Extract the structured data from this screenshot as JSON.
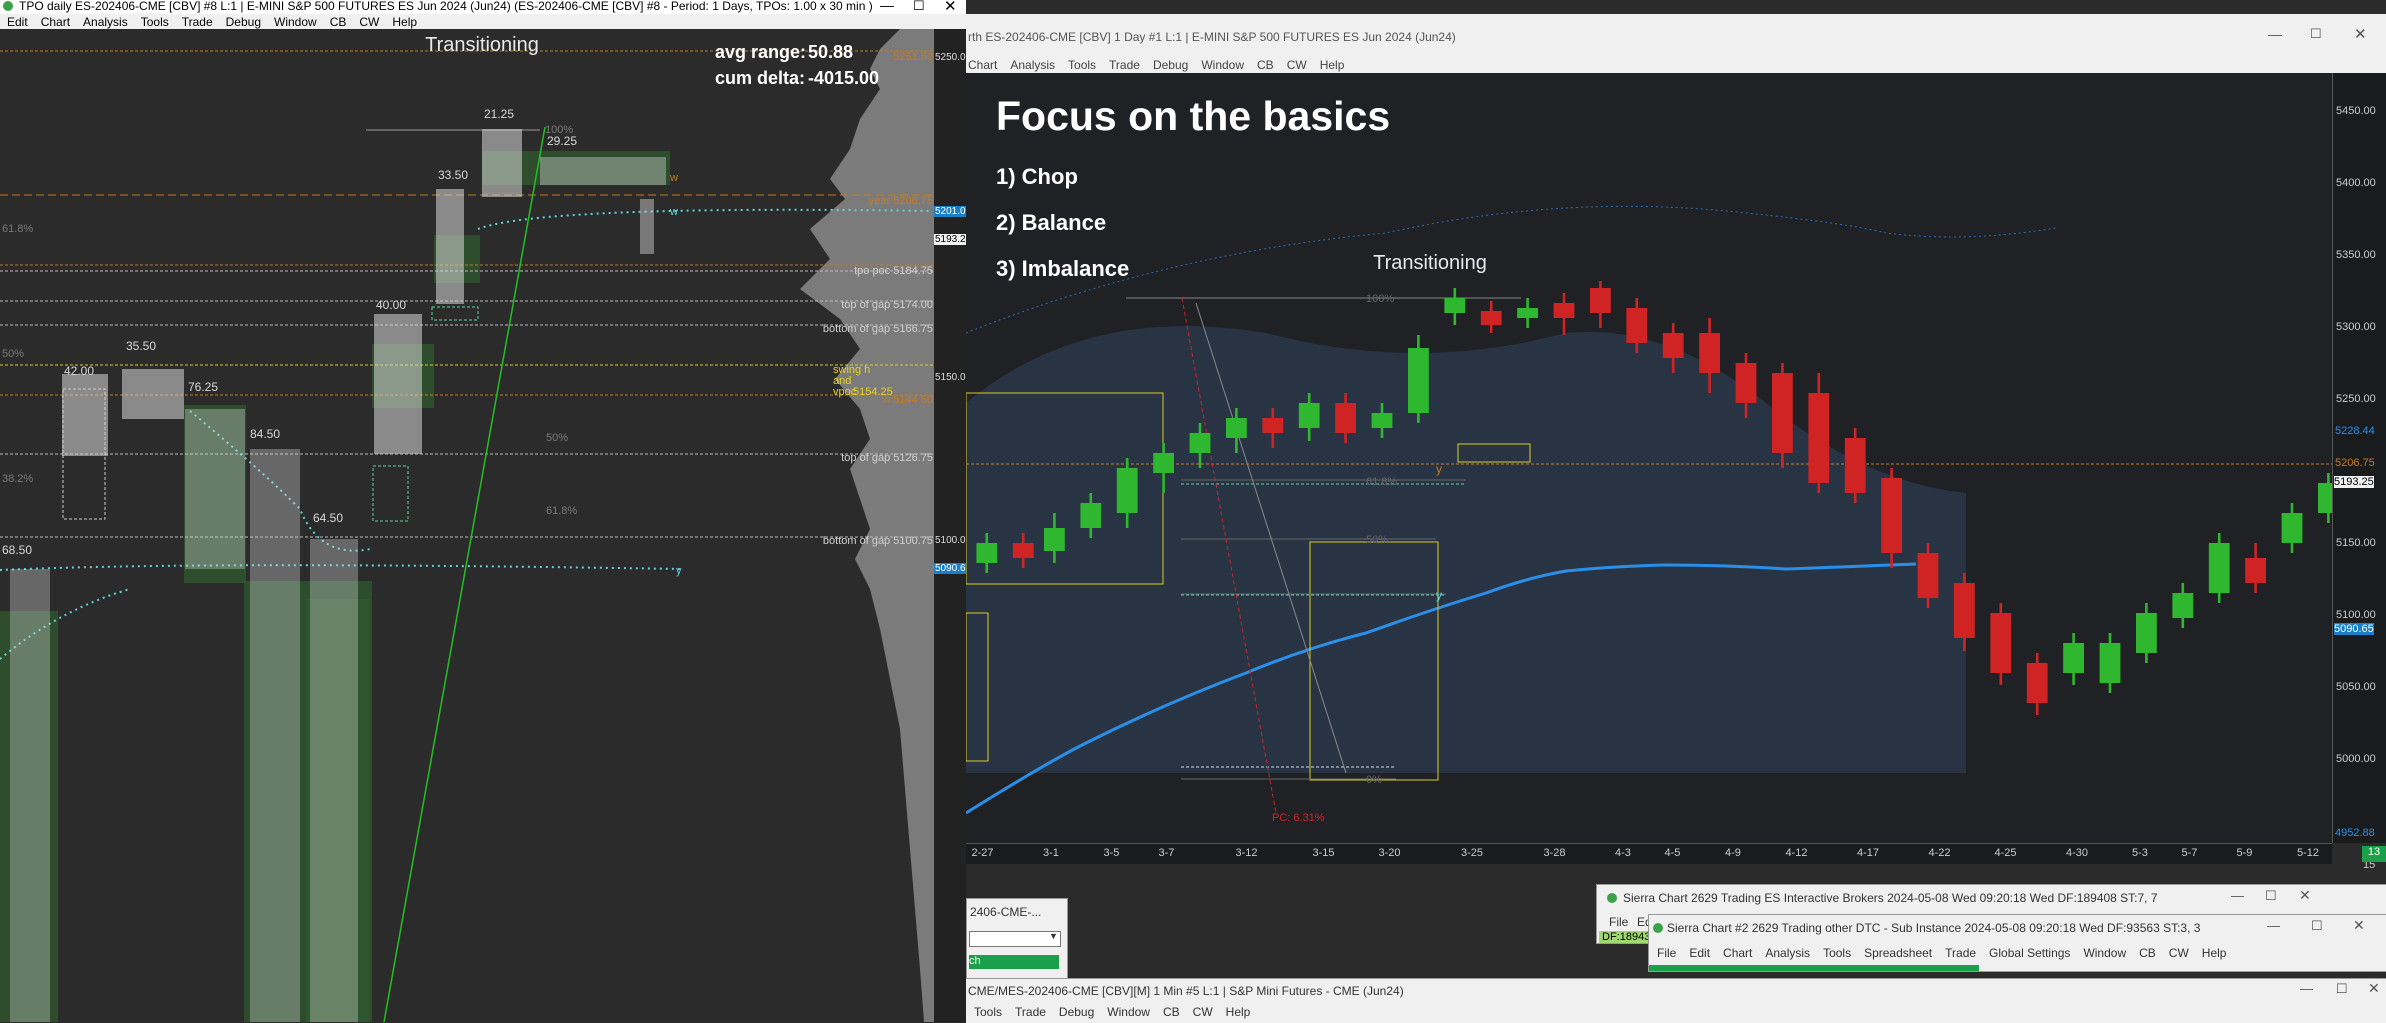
{
  "left_window": {
    "title": "TPO daily ES-202406-CME [CBV] #8 L:1 | E-MINI S&P 500 FUTURES ES Jun 2024 (Jun24) (ES-202406-CME [CBV] #8 - Period: 1 Days, TPOs: 1.00 x 30 min )",
    "menu": [
      "Edit",
      "Chart",
      "Analysis",
      "Tools",
      "Trade",
      "Debug",
      "Window",
      "CB",
      "CW",
      "Help"
    ],
    "chart": {
      "heading": "Transitioning",
      "avg_range_label": "avg range:",
      "avg_range_value": "50.88",
      "cum_delta_label": "cum delta:",
      "cum_delta_value": "-4015.00",
      "ranges": [
        "21.25",
        "29.25",
        "33.50",
        "40.00",
        "35.50",
        "42.00",
        "76.25",
        "84.50",
        "64.50",
        "68.50"
      ],
      "fib": [
        "61.8%",
        "50%",
        "38.2%",
        "50%",
        "61.8%",
        "100%"
      ],
      "level_tags": [
        {
          "text": "5251.50",
          "color": "#c77b1f"
        },
        {
          "text": "year 5206.75",
          "color": "#c77b1f"
        },
        {
          "text": "tpo poc 5184.75",
          "color": "#d0d0d0"
        },
        {
          "text": "top of gap 5174.00",
          "color": "#d0d0d0"
        },
        {
          "text": "bottom of gap 5166.75",
          "color": "#d0d0d0"
        },
        {
          "text": "w 5144.50",
          "color": "#c77b1f"
        },
        {
          "text": "top of gap 5126.75",
          "color": "#d0d0d0"
        },
        {
          "text": "bottom of gap 5100.75",
          "color": "#d0d0d0"
        }
      ],
      "swing_label": [
        "swing h",
        "and",
        "vpoc",
        "5154.25"
      ],
      "axis": [
        "5250.00",
        "5201.00",
        "5193.25",
        "5150.00",
        "5100.00",
        "5090.65"
      ],
      "letters": {
        "w1": "w",
        "w2": "w",
        "y": "y"
      }
    }
  },
  "right_window": {
    "title": "rth ES-202406-CME [CBV]  1 Day  #1 L:1 | E-MINI S&P 500 FUTURES ES Jun 2024 (Jun24)",
    "menu": [
      "Chart",
      "Analysis",
      "Tools",
      "Trade",
      "Debug",
      "Window",
      "CB",
      "CW",
      "Help"
    ],
    "chart": {
      "heading": "Focus on the basics",
      "points": [
        "1)  Chop",
        "2)  Balance",
        "3)  Imbalance"
      ],
      "transitioning": "Transitioning",
      "fib": [
        "100%",
        "61.8%",
        "50%",
        "0%"
      ],
      "pc_label": "PC: 6.31%",
      "price_axis": [
        "5450.00",
        "5400.00",
        "5350.00",
        "5300.00",
        "5250.00",
        "5228.44",
        "5206.75",
        "5193.25",
        "5150.00",
        "5100.00",
        "5090.65",
        "5050.00",
        "5000.00",
        "4952.88"
      ],
      "date_axis": [
        "2-27",
        "3-1",
        "3-5",
        "3-7",
        "3-12",
        "3-15",
        "3-20",
        "3-25",
        "3-28",
        "4-3",
        "4-5",
        "4-9",
        "4-12",
        "4-17",
        "4-22",
        "4-25",
        "4-30",
        "5-3",
        "5-7",
        "5-9",
        "5-12",
        "5-15"
      ],
      "corner_value": "13",
      "y_letters": [
        "y",
        "y"
      ]
    }
  },
  "bottom_windows": {
    "ib_title": "Sierra Chart 2629 Trading ES Interactive Brokers 2024-05-08 Wed 09:20:18 Wed DF:189408  ST:7, 7",
    "ib_menu": [
      "File",
      "Ed"
    ],
    "ib_df": "DF:18943",
    "dtc_title": "Sierra Chart #2 2629 Trading other DTC - Sub Instance 2024-05-08 09:20:18 Wed DF:93563  ST:3, 3",
    "dtc_menu": [
      "File",
      "Edit",
      "Chart",
      "Analysis",
      "Tools",
      "Spreadsheet",
      "Trade",
      "Global Settings",
      "Window",
      "CB",
      "CW",
      "Help"
    ],
    "small_title": "2406-CME-...",
    "small_tab": "ch",
    "mes_title": "CME/MES-202406-CME [CBV][M]  1 Min  #5 L:1 | S&P Mini Futures - CME (Jun24)",
    "mes_menu": [
      "Tools",
      "Trade",
      "Debug",
      "Window",
      "CB",
      "CW",
      "Help"
    ]
  },
  "colors": {
    "chart_bg": "#2b2b2b",
    "right_chart_bg": "#1f2124",
    "orange": "#c77b1f",
    "cyan": "#5fd4d8",
    "green_line": "#22c022",
    "candle_up": "#2fb82f",
    "candle_down": "#d02424",
    "blue_ma": "#2a8fe8",
    "yellow_box": "#d8d020"
  }
}
